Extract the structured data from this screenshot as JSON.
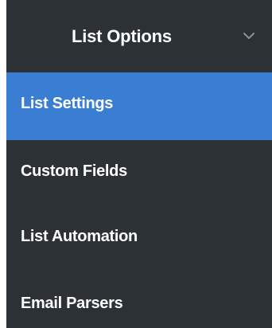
{
  "menu": {
    "title": "List Options",
    "expand_icon": "chevron-down-icon",
    "items": [
      {
        "label": "List Settings",
        "active": true
      },
      {
        "label": "Custom Fields",
        "active": false
      },
      {
        "label": "List Automation",
        "active": false
      },
      {
        "label": "Email Parsers",
        "active": false
      }
    ]
  },
  "colors": {
    "panel_background": "#2b3135",
    "active_item": "#3a7ed4",
    "text": "#ffffff",
    "chevron": "#8a9197"
  }
}
